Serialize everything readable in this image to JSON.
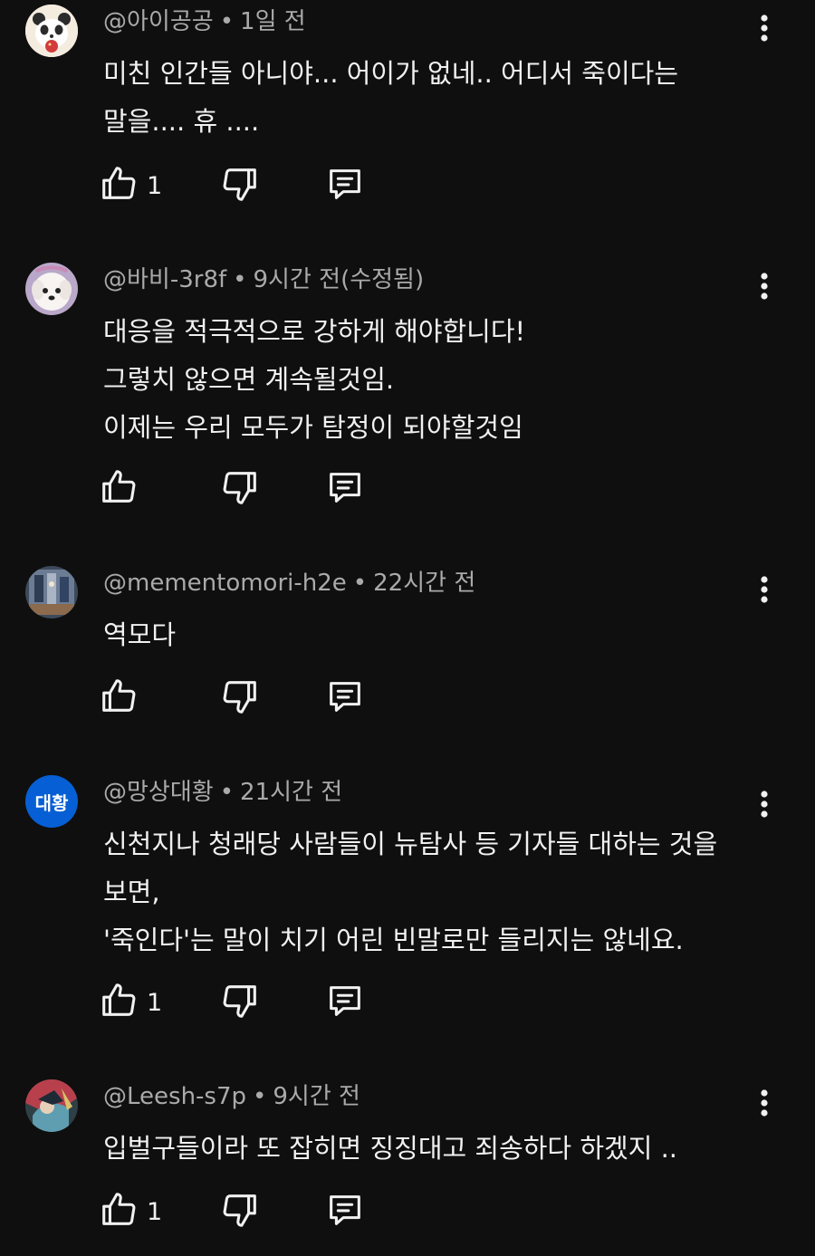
{
  "colors": {
    "background": "#0f0f0f",
    "text_primary": "#f1f1f1",
    "text_secondary": "#aaaaaa",
    "avatar_badge": "#065fd4"
  },
  "icons": {
    "like": "thumbs-up-icon",
    "dislike": "thumbs-down-icon",
    "reply": "reply-icon",
    "more": "more-vertical-icon"
  },
  "separator": "•",
  "comments": [
    {
      "author": "@아이공공",
      "time": "1일 전",
      "lines": [
        "미친  인간들  아니야... 어이가 없네.. 어디서  죽이다는",
        "말을.... 휴 ...."
      ],
      "likes": "1",
      "avatar": "panda-avatar"
    },
    {
      "author": "@바비-3r8f",
      "time": "9시간 전(수정됨)",
      "lines": [
        "대응을 적극적으로 강하게 해야합니다!",
        "그렇치 않으면 계속될것임.",
        "이제는 우리 모두가 탐정이 되야할것임"
      ],
      "likes": "",
      "avatar": "white-dog-avatar"
    },
    {
      "author": "@mementomori-h2e",
      "time": "22시간 전",
      "lines": [
        "역모다"
      ],
      "likes": "",
      "avatar": "painting-avatar"
    },
    {
      "author": "@망상대황",
      "time": "21시간 전",
      "lines": [
        "신천지나 청래당 사람들이 뉴탐사 등 기자들 대하는 것을",
        "보면,",
        "'죽인다'는 말이 치기 어린 빈말로만 들리지는 않네요."
      ],
      "likes": "1",
      "avatar": "initials-avatar",
      "avatar_text": "대황"
    },
    {
      "author": "@Leesh-s7p",
      "time": "9시간 전",
      "lines": [
        "입벌구들이라 또 잡히면 징징대고 죄송하다 하겠지 .."
      ],
      "likes": "1",
      "avatar": "character-avatar"
    }
  ]
}
